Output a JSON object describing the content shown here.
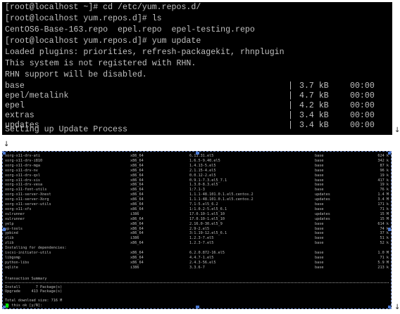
{
  "terminal_top": {
    "lines": [
      "[root@localhost ~]# cd /etc/yum.repos.d/",
      "[root@localhost yum.repos.d]# ls",
      "CentOS6-Base-163.repo  epel.repo  epel-testing.repo",
      "[root@localhost yum.repos.d]# yum update",
      "Loaded plugins: priorities, refresh-packagekit, rhnplugin",
      "This system is not registered with RHN.",
      "RHN support will be disabled."
    ],
    "repos": [
      {
        "name": "base",
        "size": "3.7 kB",
        "time": "00:00"
      },
      {
        "name": "epel/metalink",
        "size": "4.7 kB",
        "time": "00:00"
      },
      {
        "name": "epel",
        "size": "4.2 kB",
        "time": "00:00"
      },
      {
        "name": "extras",
        "size": "3.4 kB",
        "time": "00:00"
      },
      {
        "name": "updates",
        "size": "3.4 kB",
        "time": "00:00"
      }
    ],
    "separator": "|",
    "last_line": "Setting up Update Process"
  },
  "arrows": {
    "right": "↓",
    "middle": "↓",
    "bottom": "↓"
  },
  "terminal_bottom": {
    "packages": [
      {
        "name": "xorg-x11-drv-ati",
        "arch": "x86_64",
        "version": "6.13.31.el5",
        "repo": "base",
        "size": "624 k"
      },
      {
        "name": "xorg-x11-drv-i810",
        "arch": "x86_64",
        "version": "1.6.5-9.40.el5",
        "repo": "base",
        "size": "342 k"
      },
      {
        "name": "xorg-x11-drv-mga",
        "arch": "x86_64",
        "version": "1.4.13-5.el5",
        "repo": "base",
        "size": "87 k"
      },
      {
        "name": "xorg-x11-drv-nv",
        "arch": "x86_64",
        "version": "2.1.15-4.el5",
        "repo": "base",
        "size": "96 k"
      },
      {
        "name": "xorg-x11-drv-qxl",
        "arch": "x86_64",
        "version": "0.0.12-2.el5",
        "repo": "base",
        "size": "19 k"
      },
      {
        "name": "xorg-x11-drv-sis",
        "arch": "x86_64",
        "version": "0.9.1-7.3.el5_7.1",
        "repo": "base",
        "size": "417 k"
      },
      {
        "name": "xorg-x11-drv-vesa",
        "arch": "x86_64",
        "version": "1.3.0-8.3.el5",
        "repo": "base",
        "size": "19 k"
      },
      {
        "name": "xorg-x11-font-utils",
        "arch": "x86_64",
        "version": "1:7.1-3",
        "repo": "base",
        "size": "76 k"
      },
      {
        "name": "xorg-x11-server-Xnest",
        "arch": "x86_64",
        "version": "1.1.1-48.101.0.1.el5.centos.2",
        "repo": "updates",
        "size": "1.4 M"
      },
      {
        "name": "xorg-x11-server-Xorg",
        "arch": "x86_64",
        "version": "1.1.1-48.101.0.1.el5.centos.2",
        "repo": "updates",
        "size": "3.4 M"
      },
      {
        "name": "xorg-x11-server-utils",
        "arch": "x86_64",
        "version": "7.1-5.el5_6.2",
        "repo": "base",
        "size": "171 k"
      },
      {
        "name": "xorg-x11-xfs",
        "arch": "x86_64",
        "version": "1:1.0.2-5.el5_6.1",
        "repo": "base",
        "size": "71 k"
      },
      {
        "name": "xulrunner",
        "arch": "i386",
        "version": "17.0.10-1.el5_10",
        "repo": "updates",
        "size": "15 M"
      },
      {
        "name": "xulrunner",
        "arch": "x86_64",
        "version": "17.0.10-1.el5_10",
        "repo": "updates",
        "size": "15 M"
      },
      {
        "name": "yelp",
        "arch": "x86_64",
        "version": "2.16.0-30.el5_9",
        "repo": "base",
        "size": "614 k"
      },
      {
        "name": "yp-tools",
        "arch": "x86_64",
        "version": "2.9-2.el5",
        "repo": "base",
        "size": "74 k"
      },
      {
        "name": "ypbind",
        "arch": "x86_64",
        "version": "3:1.19-12.el5_6.1",
        "repo": "base",
        "size": "37 k"
      },
      {
        "name": "zlib",
        "arch": "i386",
        "version": "1.2.3-7.el5",
        "repo": "base",
        "size": "51 k"
      },
      {
        "name": "zlib",
        "arch": "x86_64",
        "version": "1.2.3-7.el5",
        "repo": "base",
        "size": "52 k"
      }
    ],
    "deps_header": "Installing for dependencies:",
    "deps": [
      {
        "name": "iscsi-initiator-utils",
        "arch": "x86_64",
        "version": "6.2.0.872-16.el5",
        "repo": "base",
        "size": "1.0 M"
      },
      {
        "name": "libgomp",
        "arch": "x86_64",
        "version": "4.4.7-1.el5",
        "repo": "base",
        "size": "71 k"
      },
      {
        "name": "python-libs",
        "arch": "x86_64",
        "version": "2.4.3-56.el5",
        "repo": "base",
        "size": "5.9 M"
      },
      {
        "name": "sqlite",
        "arch": "i386",
        "version": "3.3.6-7",
        "repo": "base",
        "size": "213 k"
      }
    ],
    "summary_title": "Transaction Summary",
    "install_line": "Install       7 Package(s)",
    "upgrade_line": "Upgrade     413 Package(s)",
    "download_line": "Total download size: 716 M",
    "prompt": "Is this ok [y/N]: "
  },
  "colors": {
    "terminal_bg": "#000000",
    "terminal_fg": "#c0c0c0",
    "cursor": "#00e000",
    "frame": "#4a78d0"
  }
}
